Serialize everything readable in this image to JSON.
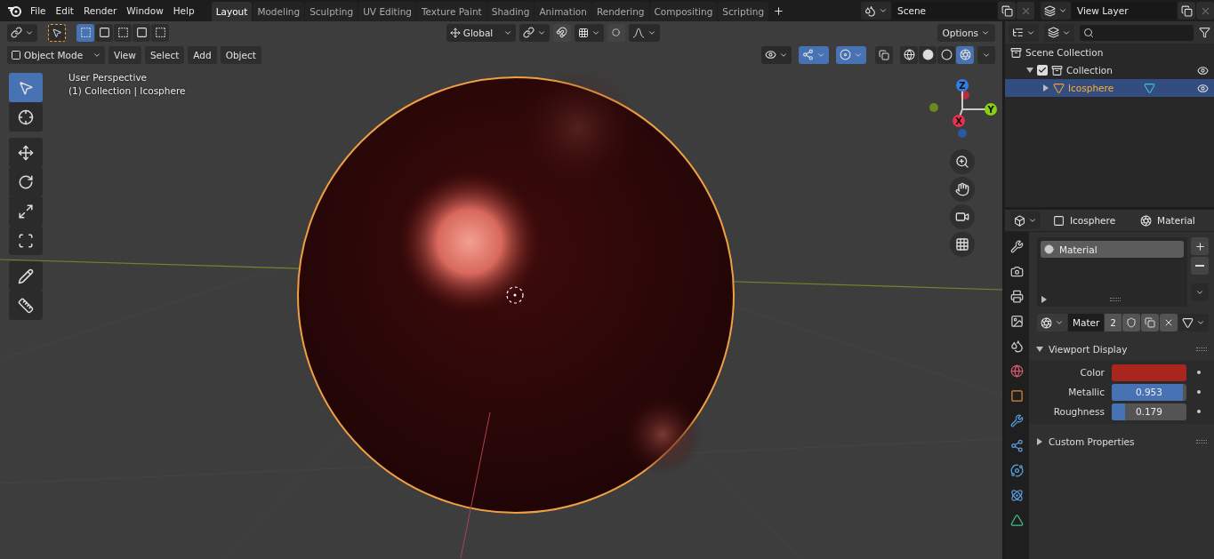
{
  "menu": [
    "File",
    "Edit",
    "Render",
    "Window",
    "Help"
  ],
  "workspaces": [
    {
      "label": "Layout",
      "selected": true
    },
    {
      "label": "Modeling",
      "selected": false
    },
    {
      "label": "Sculpting",
      "selected": false
    },
    {
      "label": "UV Editing",
      "selected": false
    },
    {
      "label": "Texture Paint",
      "selected": false
    },
    {
      "label": "Shading",
      "selected": false
    },
    {
      "label": "Animation",
      "selected": false
    },
    {
      "label": "Rendering",
      "selected": false
    },
    {
      "label": "Compositing",
      "selected": false
    },
    {
      "label": "Scripting",
      "selected": false
    }
  ],
  "scene": {
    "value": "Scene"
  },
  "view_layer": {
    "value": "View Layer"
  },
  "viewport": {
    "select_modes": [
      {
        "selected": true
      },
      {
        "selected": false
      },
      {
        "selected": false
      },
      {
        "selected": false
      },
      {
        "selected": false
      }
    ],
    "orientation": "Global",
    "options": "Options",
    "mode": "Object Mode",
    "menus": [
      "View",
      "Select",
      "Add",
      "Object"
    ],
    "toggles": [
      {
        "selected": false
      },
      {
        "selected": true
      },
      {
        "selected": true
      }
    ],
    "shading": [
      {
        "selected": false
      },
      {
        "selected": false
      },
      {
        "selected": false
      },
      {
        "selected": true
      }
    ],
    "overlay_text": [
      "User Perspective",
      "(1) Collection | Icosphere"
    ],
    "tools": [
      {
        "selected": true
      },
      {
        "selected": false
      },
      {
        "selected": false
      },
      {
        "selected": false
      },
      {
        "selected": false
      },
      {
        "selected": false
      },
      {
        "selected": false
      },
      {
        "selected": false
      }
    ],
    "axes": [
      "Z",
      "X",
      "Y"
    ]
  },
  "outliner": {
    "items": [
      {
        "label": "Scene Collection",
        "children": [
          {
            "label": "Collection",
            "checked": true,
            "expanded": true,
            "selected": false,
            "children": [
              {
                "label": "Icosphere",
                "expanded": false,
                "selected": true
              }
            ]
          }
        ]
      }
    ]
  },
  "properties": {
    "object": "Icosphere",
    "context": "Material",
    "slots": [
      {
        "label": "Material",
        "selected": true
      }
    ],
    "material_name": "Mater",
    "users": "2",
    "panels": [
      {
        "label": "Viewport Display",
        "expanded": true,
        "fields": [
          {
            "kind": "color",
            "label": "Color",
            "color": "#a8261e"
          },
          {
            "kind": "slider",
            "label": "Metallic",
            "value": "0.953",
            "level": 0.953
          },
          {
            "kind": "slider",
            "label": "Roughness",
            "value": "0.179",
            "level": 0.179
          }
        ]
      },
      {
        "label": "Custom Properties",
        "expanded": false
      }
    ]
  }
}
